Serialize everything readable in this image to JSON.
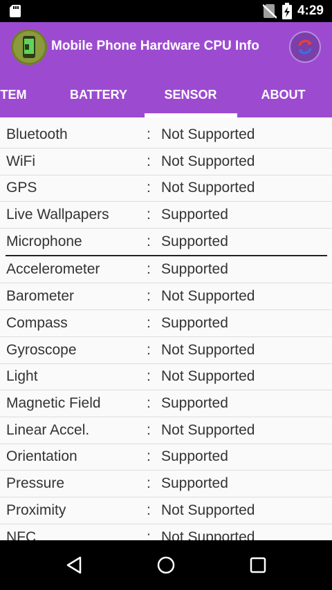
{
  "status_bar": {
    "time": "4:29",
    "icons": [
      "sd-card-icon",
      "no-sim-icon",
      "battery-charging-icon"
    ]
  },
  "app_bar": {
    "title": "Mobile Phone Hardware CPU Info",
    "logo_icon": "phone-chip-logo-icon",
    "refresh_icon": "refresh-icon"
  },
  "tabs": [
    {
      "label": "STEM",
      "active": false
    },
    {
      "label": "BATTERY",
      "active": false
    },
    {
      "label": "SENSOR",
      "active": true
    },
    {
      "label": "ABOUT",
      "active": false
    }
  ],
  "separator": ":",
  "features": [
    {
      "name": "Bluetooth",
      "value": "Not Supported"
    },
    {
      "name": "WiFi",
      "value": "Not Supported"
    },
    {
      "name": "GPS",
      "value": "Not Supported"
    },
    {
      "name": "Live Wallpapers",
      "value": "Supported"
    },
    {
      "name": "Microphone",
      "value": "Supported"
    }
  ],
  "sensors": [
    {
      "name": "Accelerometer",
      "value": "Supported"
    },
    {
      "name": "Barometer",
      "value": "Not Supported"
    },
    {
      "name": "Compass",
      "value": "Supported"
    },
    {
      "name": "Gyroscope",
      "value": "Not Supported"
    },
    {
      "name": "Light",
      "value": "Not Supported"
    },
    {
      "name": "Magnetic Field",
      "value": "Supported"
    },
    {
      "name": "Linear Accel.",
      "value": "Not Supported"
    },
    {
      "name": "Orientation",
      "value": "Supported"
    },
    {
      "name": "Pressure",
      "value": "Supported"
    },
    {
      "name": "Proximity",
      "value": "Not Supported"
    },
    {
      "name": "NFC",
      "value": "Not Supported"
    }
  ],
  "colors": {
    "app_bar": "#9c4bd1",
    "list_background": "#fafafa",
    "text": "#333333"
  },
  "nav_bar": {
    "icons": [
      "back-icon",
      "home-icon",
      "recents-icon"
    ]
  }
}
